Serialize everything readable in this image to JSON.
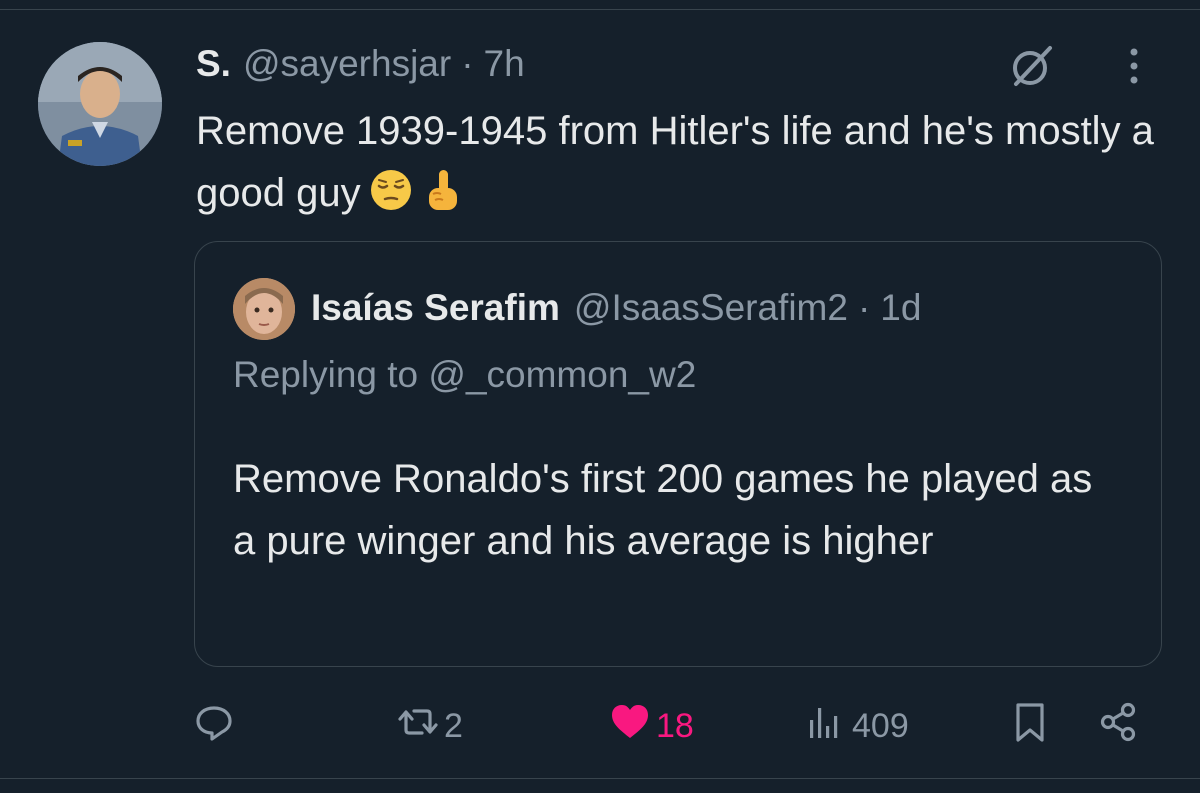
{
  "tweet": {
    "display_name": "S.",
    "handle": "@sayerhsjar",
    "separator": "·",
    "time": "7h",
    "text": "Remove 1939-1945 from Hitler's life and he's mostly a good guy",
    "emojis": [
      "pensive-face",
      "index-pointing-up"
    ]
  },
  "quoted_tweet": {
    "display_name": "Isaías Serafim",
    "handle": "@IsaasSerafim2",
    "separator": "·",
    "time": "1d",
    "replying_to": "Replying to @_common_w2",
    "text": "Remove Ronaldo's first 200 games he played as a pure winger and his average is higher"
  },
  "actions": {
    "reply": {
      "icon": "reply-icon",
      "count": ""
    },
    "retweet": {
      "icon": "retweet-icon",
      "count": "2"
    },
    "like": {
      "icon": "heart-icon",
      "count": "18",
      "active": true,
      "color": "#f91880"
    },
    "views": {
      "icon": "views-icon",
      "count": "409"
    },
    "bookmark": {
      "icon": "bookmark-icon"
    },
    "share": {
      "icon": "share-icon"
    }
  },
  "colors": {
    "background": "#15202b",
    "text_primary": "#e7e9ea",
    "text_secondary": "#8b98a5",
    "border": "#38444d",
    "like_pink": "#f91880"
  }
}
